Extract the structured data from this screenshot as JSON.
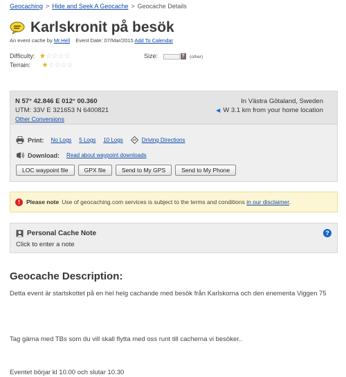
{
  "breadcrumb": [
    "Geocaching",
    "Hide and Seek A Geocache",
    "Geocache Details"
  ],
  "cache": {
    "name": "Karlskronit på besök",
    "owner_prefix": "An event cache by",
    "owner": "Mr.Hell",
    "event_date_label": "Event Date: 07/Mar/2015",
    "add_calendar": "Add To Calendar",
    "difficulty_label": "Difficulty:",
    "terrain_label": "Terrain:",
    "difficulty_stars": 1,
    "terrain_stars": 1,
    "size_label": "Size:",
    "size_value": "(other)"
  },
  "coords": {
    "main": "N 57° 42.846 E 012° 00.360",
    "utm": "UTM: 33V E 321653 N 6400821",
    "other": "Other Conversions",
    "location": "In Västra Götaland, Sweden",
    "distance": "W 3.1 km from your home location"
  },
  "print": {
    "label": "Print:",
    "no_logs": "No Logs",
    "five_logs": "5 Logs",
    "ten_logs": "10 Logs",
    "directions": "Driving Directions"
  },
  "download": {
    "label": "Download:",
    "read_about": "Read about waypoint downloads"
  },
  "buttons": [
    "LOC waypoint file",
    "GPX file",
    "Send to My GPS",
    "Send to My Phone"
  ],
  "notice": {
    "bold": "Please note",
    "text": "Use of geocaching.com services is subject to the terms and conditions",
    "link": "in our disclaimer",
    "end": "."
  },
  "personal_note": {
    "title": "Personal Cache Note",
    "click": "Click to enter a note"
  },
  "description": {
    "heading": "Geocache Description:",
    "p1": "Detta event är startskottet på en hel helg cachande med besök från Karlskorna och den enementa Viggen 75",
    "p2": "Tag gärna med TBs som du vill skall flytta med oss runt till cacherna vi besöker..",
    "p3": "Eventet börjar kl 10.00 och slutar 10.30"
  },
  "colors": {
    "link": "#0d4aa8",
    "star": "#e0b010",
    "notice_bg": "#fdf6d4",
    "alert": "#e02020"
  }
}
